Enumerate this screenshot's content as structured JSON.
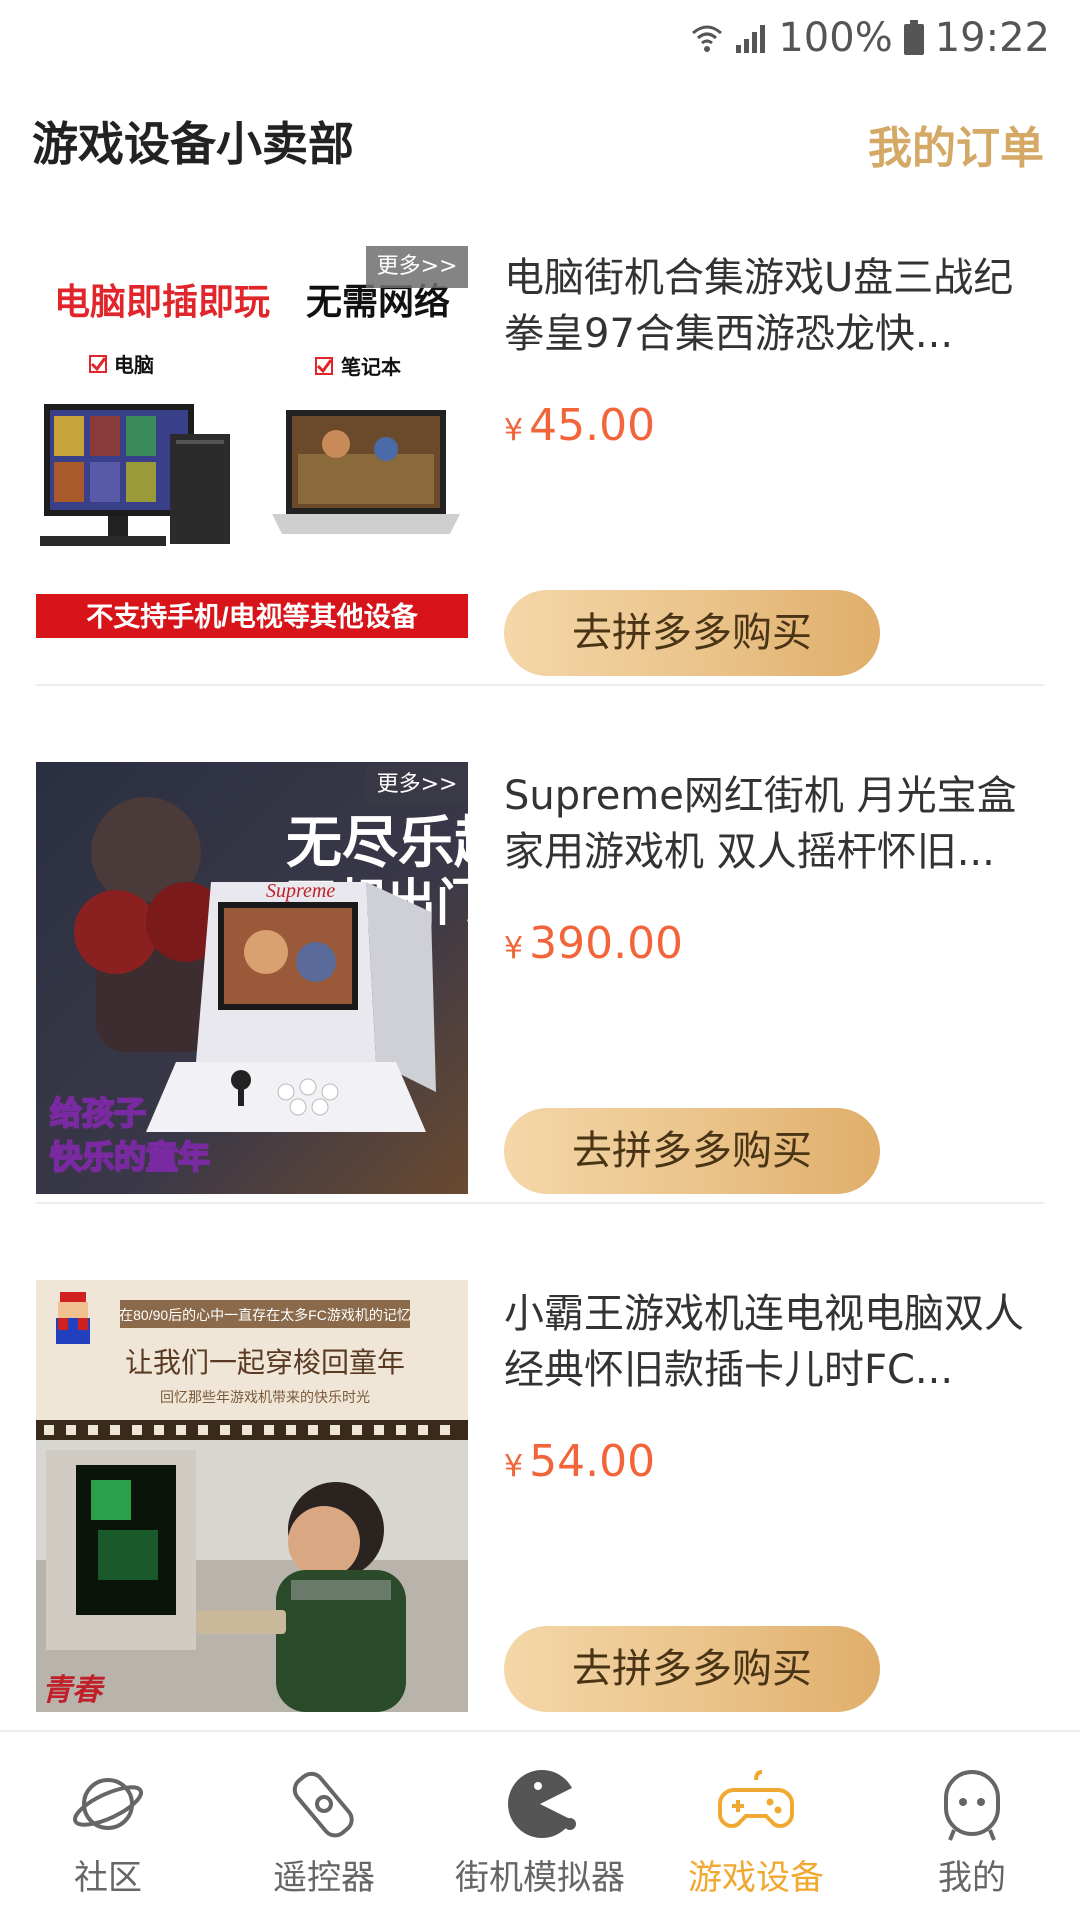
{
  "status_bar": {
    "battery": "100%",
    "time": "19:22"
  },
  "header": {
    "title": "游戏设备小卖部",
    "orders_link": "我的订单"
  },
  "products": [
    {
      "title": "电脑街机合集游戏U盘三战纪拳皇97合集西游恐龙快...",
      "currency": "¥",
      "price": "45.00",
      "buy_label": "去拼多多购买",
      "more_badge": "更多>>",
      "image_text": [
        "电脑即插即玩",
        "无需网络",
        "电脑",
        "笔记本",
        "不支持手机/电视等其他设备"
      ]
    },
    {
      "title": "Supreme网红街机 月光宝盒家用游戏机 双人摇杆怀旧...",
      "currency": "¥",
      "price": "390.00",
      "buy_label": "去拼多多购买",
      "more_badge": "更多>>",
      "image_text": [
        "无尽乐趣",
        "不想出门",
        "给孩子",
        "快乐的童年",
        "Supreme"
      ]
    },
    {
      "title": "小霸王游戏机连电视电脑双人经典怀旧款插卡儿时FC...",
      "currency": "¥",
      "price": "54.00",
      "buy_label": "去拼多多购买",
      "more_badge": "",
      "image_text": [
        "在80/90后的心中一直存在太多FC游戏机的记忆",
        "让我们一起穿梭回童年",
        "回忆那些年游戏机带来的快乐时光"
      ]
    }
  ],
  "bottom_nav": {
    "items": [
      {
        "label": "社区",
        "icon": "planet-icon"
      },
      {
        "label": "遥控器",
        "icon": "remote-icon"
      },
      {
        "label": "街机模拟器",
        "icon": "pacman-icon"
      },
      {
        "label": "游戏设备",
        "icon": "gamepad-icon"
      },
      {
        "label": "我的",
        "icon": "profile-icon"
      }
    ],
    "active_index": 3
  },
  "colors": {
    "accent": "#d4a865",
    "price": "#f2643a",
    "active_tab": "#f0a830"
  }
}
